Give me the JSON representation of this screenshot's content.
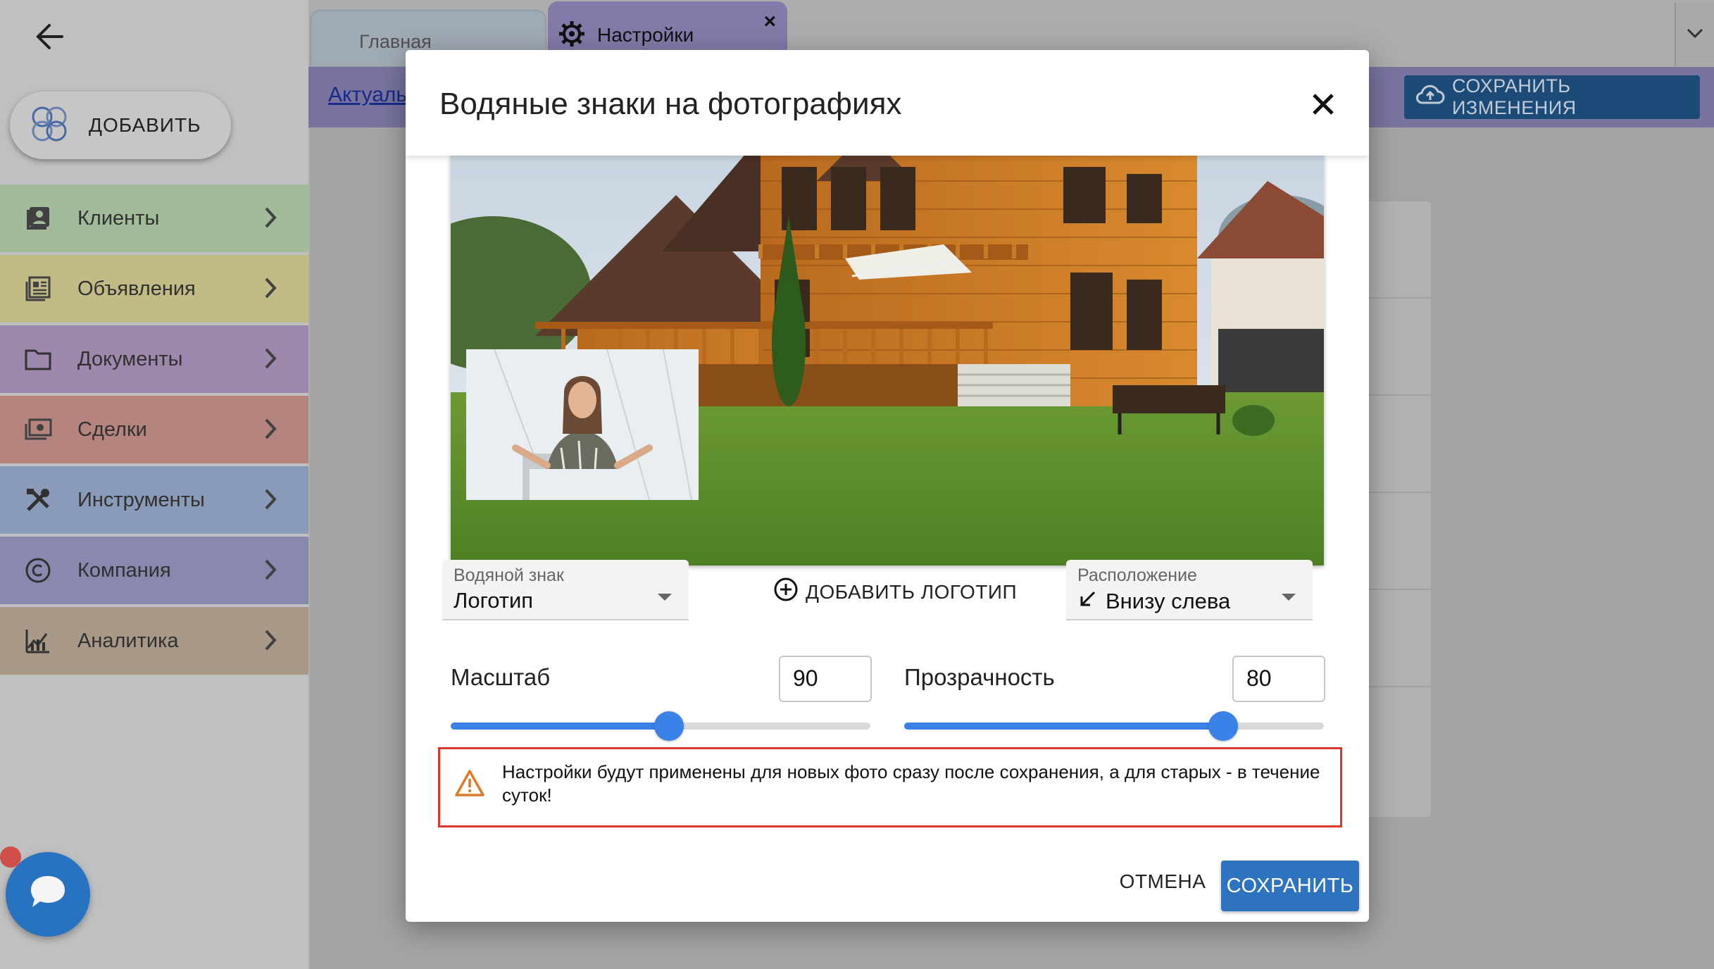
{
  "sidebar": {
    "add_label": "ДОБАВИТЬ",
    "items": [
      {
        "label": "Клиенты",
        "icon": "contacts-icon",
        "color": "#a9c4a0"
      },
      {
        "label": "Объявления",
        "icon": "newspaper-icon",
        "color": "#c9c48c"
      },
      {
        "label": "Документы",
        "icon": "folder-icon",
        "color": "#a48fb6"
      },
      {
        "label": "Сделки",
        "icon": "money-icon",
        "color": "#bd8a85"
      },
      {
        "label": "Инструменты",
        "icon": "tools-icon",
        "color": "#8fa2c0"
      },
      {
        "label": "Компания",
        "icon": "copyright-icon",
        "color": "#8f8fb8"
      },
      {
        "label": "Аналитика",
        "icon": "analytics-icon",
        "color": "#b0a08e"
      }
    ]
  },
  "tabs": {
    "home": "Главная",
    "settings": "Настройки",
    "close": "×"
  },
  "subbar": {
    "link": "Актуаль",
    "save_changes": "СОХРАНИТЬ ИЗМЕНЕНИЯ"
  },
  "dialog": {
    "title": "Водяные знаки на фотографиях",
    "watermark_select": {
      "caption": "Водяной знак",
      "value": "Логотип"
    },
    "add_logo": "ДОБАВИТЬ ЛОГОТИП",
    "position_select": {
      "caption": "Расположение",
      "value": "Внизу слева"
    },
    "scale": {
      "label": "Масштаб",
      "value": "90",
      "fraction": 0.52
    },
    "opacity": {
      "label": "Прозрачность",
      "value": "80",
      "fraction": 0.76
    },
    "notice": "Настройки будут применены для новых фото сразу после сохранения, а для старых - в течение суток!",
    "cancel": "ОТМЕНА",
    "save": "СОХРАНИТЬ"
  },
  "colors": {
    "accent": "#2d73bf",
    "slider": "#3b82e8",
    "warning_border": "#d9392b",
    "warning_icon": "#e07a2a"
  }
}
